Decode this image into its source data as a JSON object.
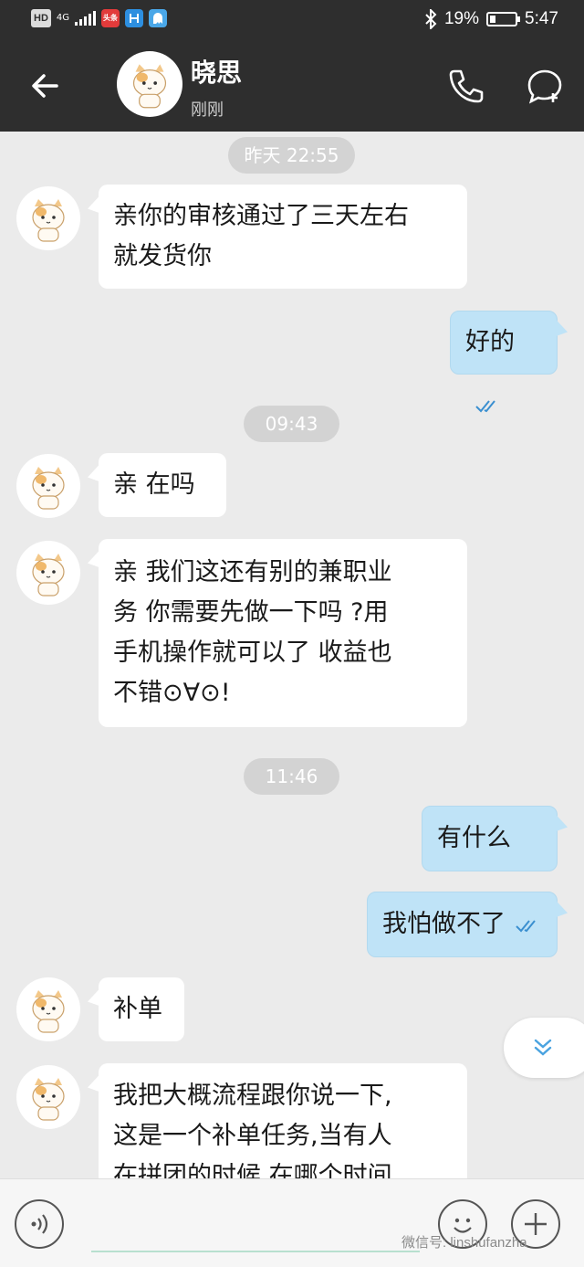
{
  "status_bar": {
    "hd": "HD",
    "network": "4G",
    "app_badge": "头条",
    "battery": "19%",
    "time": "5:47"
  },
  "header": {
    "contact_name": "晓思",
    "last_seen": "刚刚"
  },
  "messages": {
    "ts1": "昨天 22:55",
    "m1": "亲你的审核通过了三天左右",
    "m1b": "就发货你",
    "m2": "好的",
    "ts2": "09:43",
    "m3": "亲  在吗",
    "m4a": "亲 我们这还有别的兼职业",
    "m4b": "务 你需要先做一下吗 ?用",
    "m4c": "手机操作就可以了 收益也",
    "m4d": "不错⊙∀⊙!",
    "ts3": "11:46",
    "m5": "有什么",
    "m6": "我怕做不了",
    "m7": "补单",
    "m8a": "我把大概流程跟你说一下,",
    "m8b": "这是一个补单任务,当有人",
    "m8c": "在拼团的时候,在哪个时间"
  },
  "input": {
    "placeholder": ""
  },
  "watermark": "微信号: linshufanzha",
  "colors": {
    "header_bg": "#2e2e2e",
    "chat_bg": "#ebebeb",
    "outgoing_bubble": "#bfe3f7",
    "incoming_bubble": "#ffffff",
    "tick": "#3a8fd0"
  }
}
